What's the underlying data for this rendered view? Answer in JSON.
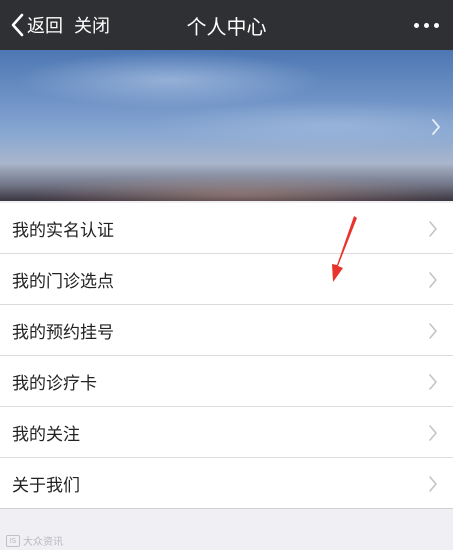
{
  "navbar": {
    "back_label": "返回",
    "close_label": "关闭",
    "title": "个人中心",
    "more_icon": "more-dots-icon",
    "background": "#2f3033"
  },
  "menu": {
    "items": [
      {
        "label": "我的实名认证"
      },
      {
        "label": "我的门诊选点"
      },
      {
        "label": "我的预约挂号"
      },
      {
        "label": "我的诊疗卡"
      },
      {
        "label": "我的关注"
      },
      {
        "label": "关于我们"
      }
    ]
  },
  "annotation": {
    "color": "#e8342c"
  },
  "watermark": {
    "text": "大众资讯"
  }
}
